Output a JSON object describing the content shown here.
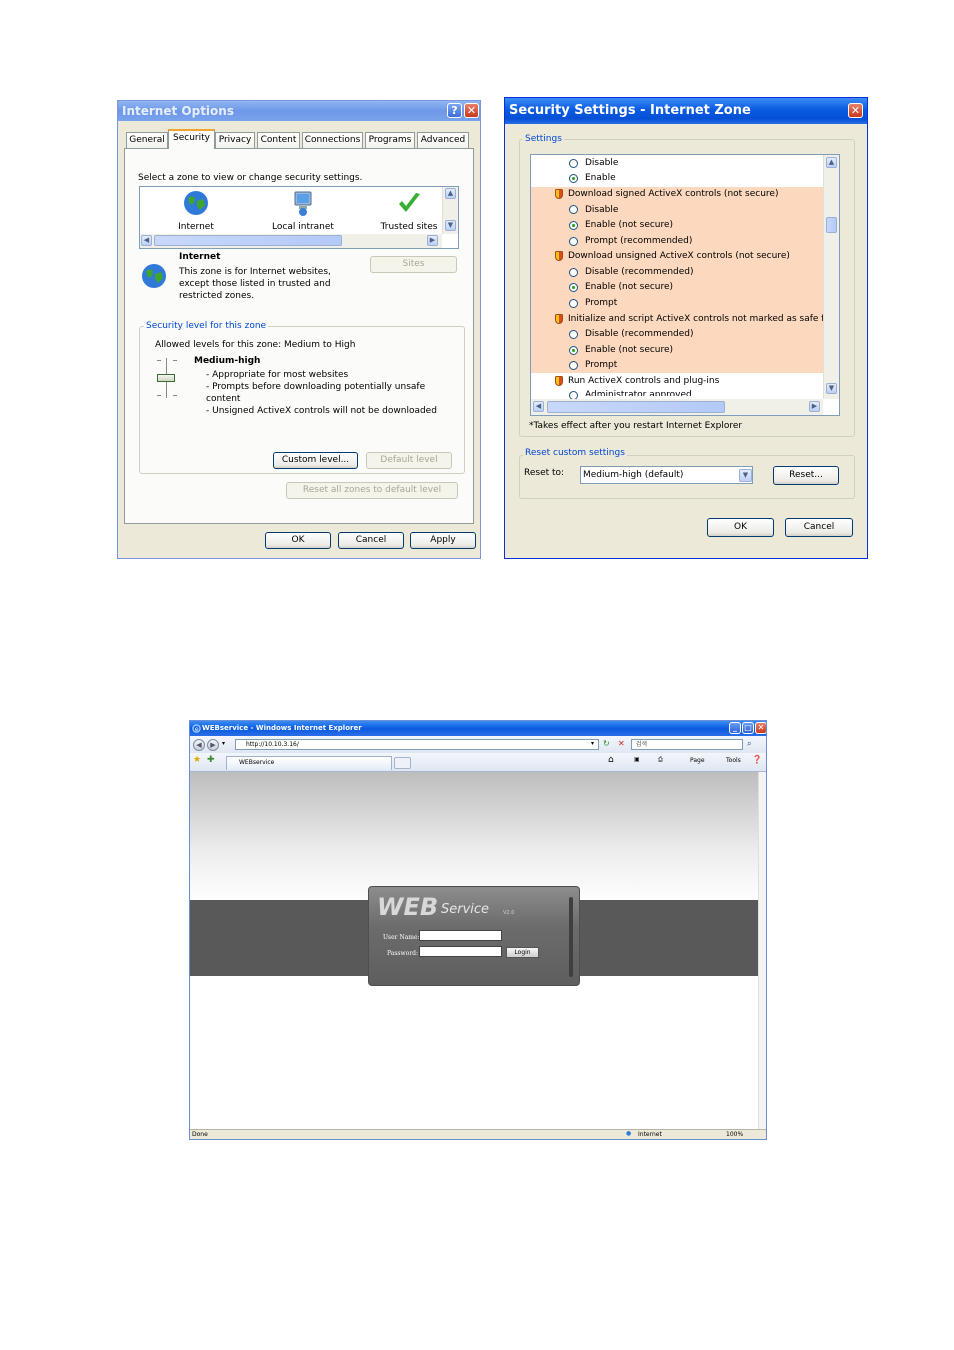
{
  "internet_options": {
    "title": "Internet Options",
    "tabs": [
      "General",
      "Security",
      "Privacy",
      "Content",
      "Connections",
      "Programs",
      "Advanced"
    ],
    "zone_prompt": "Select a zone to view or change security settings.",
    "zones": [
      "Internet",
      "Local intranet",
      "Trusted sites"
    ],
    "zone_name": "Internet",
    "zone_desc": [
      "This zone is for Internet websites,",
      "except those listed in trusted and",
      "restricted zones."
    ],
    "sites_button": "Sites",
    "security_group_label": "Security level for this zone",
    "allowed_levels": "Allowed levels for this zone: Medium to High",
    "level_name": "Medium-high",
    "level_bullets": [
      "- Appropriate for most websites",
      "- Prompts before downloading potentially unsafe",
      "content",
      "- Unsigned ActiveX controls will not be downloaded"
    ],
    "custom_level_button": "Custom level...",
    "default_level_button": "Default level",
    "reset_all_button": "Reset all zones to default level",
    "ok_button": "OK",
    "cancel_button": "Cancel",
    "apply_button": "Apply"
  },
  "security_settings": {
    "title": "Security Settings - Internet Zone",
    "settings_label": "Settings",
    "rows": {
      "r0": "Disable",
      "r1": "Enable",
      "h1": "Download signed ActiveX controls (not secure)",
      "r2": "Disable",
      "r3": "Enable (not secure)",
      "r4": "Prompt (recommended)",
      "h2": "Download unsigned ActiveX controls (not secure)",
      "r5": "Disable (recommended)",
      "r6": "Enable (not secure)",
      "r7": "Prompt",
      "h3": "Initialize and script ActiveX controls not marked as safe for sc",
      "r8": "Disable (recommended)",
      "r9": "Enable (not secure)",
      "r10": "Prompt",
      "h4": "Run ActiveX controls and plug-ins",
      "r11": "Administrator approved"
    },
    "note": "*Takes effect after you restart Internet Explorer",
    "reset_group_label": "Reset custom settings",
    "reset_to_label": "Reset to:",
    "reset_to_value": "Medium-high (default)",
    "reset_button": "Reset...",
    "ok_button": "OK",
    "cancel_button": "Cancel"
  },
  "ie": {
    "title": "WEBservice - Windows Internet Explorer",
    "address": "http://10.10.3.16/",
    "search_placeholder": "검색",
    "tab_label": "WEBservice",
    "toolbar": {
      "page": "Page",
      "tools": "Tools"
    },
    "status": "Done",
    "zone": "Internet",
    "zoom": "100%",
    "login": {
      "logo_web": "WEB",
      "logo_service": "Service",
      "logo_version": "V2.0",
      "username_label": "User Name:",
      "password_label": "Password:",
      "login_button": "Login"
    }
  }
}
